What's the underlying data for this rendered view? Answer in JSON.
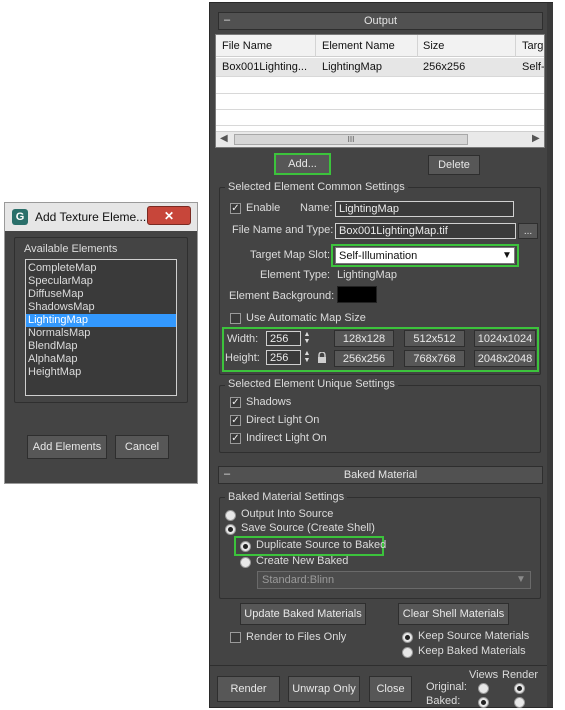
{
  "dialog": {
    "title": "Add Texture Eleme...",
    "available_label": "Available Elements",
    "elements": [
      "CompleteMap",
      "SpecularMap",
      "DiffuseMap",
      "ShadowsMap",
      "LightingMap",
      "NormalsMap",
      "BlendMap",
      "AlphaMap",
      "HeightMap"
    ],
    "selected_index": 4,
    "add_button": "Add Elements",
    "cancel_button": "Cancel"
  },
  "output": {
    "rollout_title": "Output",
    "collapse_symbol": "–",
    "columns": [
      "File Name",
      "Element Name",
      "Size",
      "Targ"
    ],
    "row": [
      "Box001Lighting...",
      "LightingMap",
      "256x256",
      "Self-I"
    ],
    "hscroll_thumb": "III",
    "add_button": "Add...",
    "delete_button": "Delete",
    "common_group": "Selected Element Common Settings",
    "enable_label": "Enable",
    "name_label": "Name:",
    "name_value": "LightingMap",
    "file_label": "File Name and Type:",
    "file_value": "Box001LightingMap.tif",
    "browse_button": "...",
    "slot_label": "Target Map Slot:",
    "slot_value": "Self-Illumination",
    "etype_label": "Element Type:",
    "etype_value": "LightingMap",
    "bg_label": "Element Background:",
    "auto_size_label": "Use Automatic Map Size",
    "width_label": "Width:",
    "width_value": "256",
    "height_label": "Height:",
    "height_value": "256",
    "size_presets": [
      "128x128",
      "512x512",
      "1024x1024",
      "256x256",
      "768x768",
      "2048x2048"
    ],
    "unique_group": "Selected Element Unique Settings",
    "shadows_label": "Shadows",
    "direct_label": "Direct Light On",
    "indirect_label": "Indirect Light On"
  },
  "baked": {
    "rollout_title": "Baked Material",
    "group": "Baked Material Settings",
    "output_into_source": "Output Into Source",
    "save_source": "Save Source (Create Shell)",
    "duplicate": "Duplicate Source to Baked",
    "create_new": "Create New Baked",
    "material_value": "Standard:Blinn",
    "update_button": "Update Baked Materials",
    "clear_button": "Clear Shell Materials",
    "render_files": "Render to Files Only",
    "keep_source": "Keep Source Materials",
    "keep_baked": "Keep Baked Materials"
  },
  "bottom": {
    "render_button": "Render",
    "unwrap_button": "Unwrap Only",
    "close_button": "Close",
    "views_label": "Views",
    "render_label": "Render",
    "original_label": "Original:",
    "baked_label": "Baked:"
  },
  "colors": {
    "panel": "#444444",
    "highlight": "#3cc33c",
    "selection": "#3399ff"
  }
}
